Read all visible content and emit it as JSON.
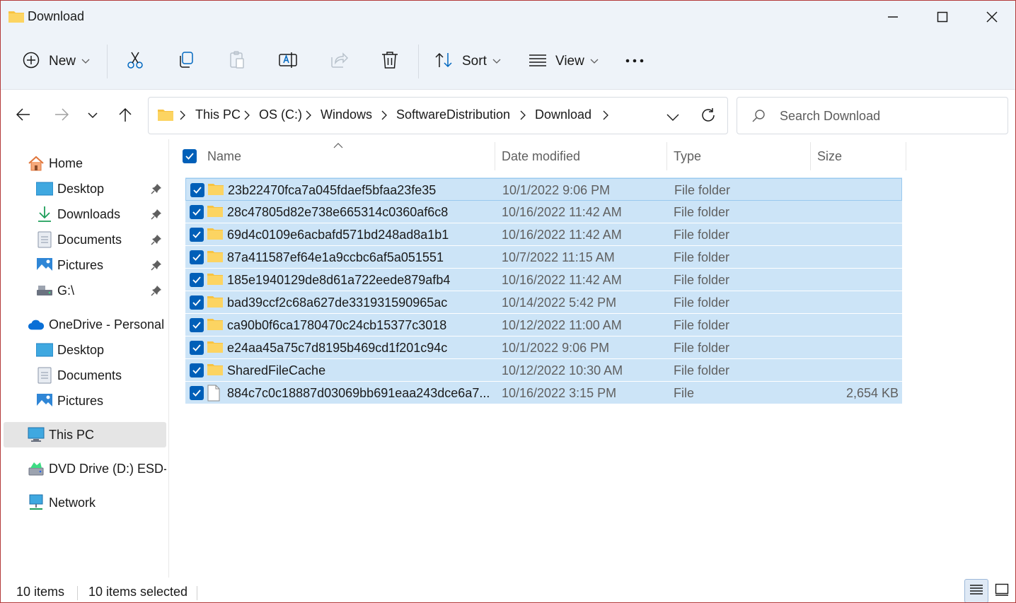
{
  "window": {
    "title": "Download"
  },
  "toolbar": {
    "new_label": "New",
    "sort_label": "Sort",
    "view_label": "View",
    "icons": [
      "new-icon",
      "cut-icon",
      "copy-icon",
      "paste-icon",
      "rename-icon",
      "share-icon",
      "delete-icon",
      "sort-icon",
      "view-icon",
      "more-icon"
    ]
  },
  "address": {
    "crumbs": [
      "This PC",
      "OS (C:)",
      "Windows",
      "SoftwareDistribution",
      "Download"
    ]
  },
  "search": {
    "placeholder": "Search Download"
  },
  "sidebar": {
    "home": "Home",
    "quick_access": [
      {
        "label": "Desktop",
        "icon": "desktop-icon"
      },
      {
        "label": "Downloads",
        "icon": "downloads-icon"
      },
      {
        "label": "Documents",
        "icon": "documents-icon"
      },
      {
        "label": "Pictures",
        "icon": "pictures-icon"
      },
      {
        "label": "G:\\",
        "icon": "drive-icon"
      }
    ],
    "onedrive": "OneDrive - Personal",
    "onedrive_items": [
      {
        "label": "Desktop",
        "icon": "desktop-icon"
      },
      {
        "label": "Documents",
        "icon": "documents-icon"
      },
      {
        "label": "Pictures",
        "icon": "pictures-icon"
      }
    ],
    "this_pc": "This PC",
    "dvd": "DVD Drive (D:) ESD-I:",
    "network": "Network"
  },
  "columns": {
    "name": "Name",
    "date": "Date modified",
    "type": "Type",
    "size": "Size"
  },
  "files": [
    {
      "name": "23b22470fca7a045fdaef5bfaa23fe35",
      "date": "10/1/2022 9:06 PM",
      "type": "File folder",
      "size": "",
      "kind": "folder"
    },
    {
      "name": "28c47805d82e738e665314c0360af6c8",
      "date": "10/16/2022 11:42 AM",
      "type": "File folder",
      "size": "",
      "kind": "folder"
    },
    {
      "name": "69d4c0109e6acbafd571bd248ad8a1b1",
      "date": "10/16/2022 11:42 AM",
      "type": "File folder",
      "size": "",
      "kind": "folder"
    },
    {
      "name": "87a411587ef64e1a9ccbc6af5a051551",
      "date": "10/7/2022 11:15 AM",
      "type": "File folder",
      "size": "",
      "kind": "folder"
    },
    {
      "name": "185e1940129de8d61a722eede879afb4",
      "date": "10/16/2022 11:42 AM",
      "type": "File folder",
      "size": "",
      "kind": "folder"
    },
    {
      "name": "bad39ccf2c68a627de331931590965ac",
      "date": "10/14/2022 5:42 PM",
      "type": "File folder",
      "size": "",
      "kind": "folder"
    },
    {
      "name": "ca90b0f6ca1780470c24cb15377c3018",
      "date": "10/12/2022 11:00 AM",
      "type": "File folder",
      "size": "",
      "kind": "folder"
    },
    {
      "name": "e24aa45a75c7d8195b469cd1f201c94c",
      "date": "10/1/2022 9:06 PM",
      "type": "File folder",
      "size": "",
      "kind": "folder"
    },
    {
      "name": "SharedFileCache",
      "date": "10/12/2022 10:30 AM",
      "type": "File folder",
      "size": "",
      "kind": "folder"
    },
    {
      "name": "884c7c0c18887d03069bb691eaa243dce6a7...",
      "date": "10/16/2022 3:15 PM",
      "type": "File",
      "size": "2,654 KB",
      "kind": "file"
    }
  ],
  "status": {
    "count": "10 items",
    "selected": "10 items selected"
  },
  "colors": {
    "selection": "#cce4f7",
    "accent": "#005fb8",
    "chrome": "#eef3f9"
  }
}
